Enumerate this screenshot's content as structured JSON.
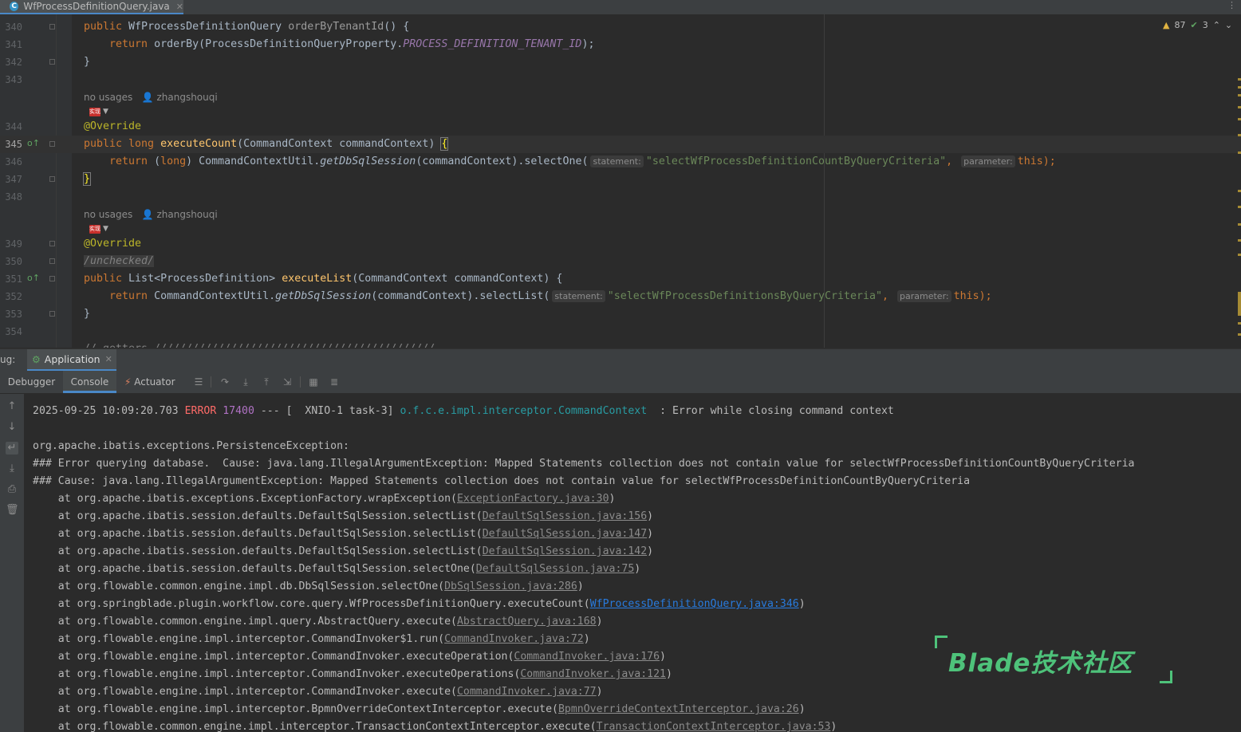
{
  "editor_tab": {
    "file_name": "WfProcessDefinitionQuery.java",
    "icon": "java-class-icon"
  },
  "inspections": {
    "warnings": "87",
    "checks": "3"
  },
  "editor_lines": [
    {
      "n": "340"
    },
    {
      "n": "341"
    },
    {
      "n": "342"
    },
    {
      "n": "343"
    },
    {
      "n": "344"
    },
    {
      "n": "345"
    },
    {
      "n": "346"
    },
    {
      "n": "347"
    },
    {
      "n": "348"
    },
    {
      "n": "349"
    },
    {
      "n": "350"
    },
    {
      "n": "351"
    },
    {
      "n": "352"
    },
    {
      "n": "353"
    },
    {
      "n": "354"
    }
  ],
  "code": {
    "l340a": "public ",
    "l340b": "WfProcessDefinitionQuery ",
    "l340c": "orderByTenantId",
    "l340d": "() {",
    "l341a": "    return ",
    "l341b": "orderBy(ProcessDefinitionQueryProperty.",
    "l341c": "PROCESS_DEFINITION_TENANT_ID",
    "l341d": ");",
    "l342": "}",
    "l344": "@Override",
    "l345a": "public long ",
    "l345b": "executeCount",
    "l345c": "(CommandContext commandContext) ",
    "l345d": "{",
    "l346a": "    return ",
    "l346b": "(long) ",
    "l346c": "CommandContextUtil.",
    "l346d": "getDbSqlSession",
    "l346e": "(commandContext).selectOne(",
    "l346s": "\"selectWfProcessDefinitionCountByQueryCriteria\"",
    "l346f": ", ",
    "l346g": "this",
    "l346h": ");",
    "l347": "}",
    "l349": "@Override",
    "l350": "/unchecked/",
    "l351a": "public ",
    "l351b": "List<ProcessDefinition> ",
    "l351c": "executeList",
    "l351d": "(CommandContext commandContext) {",
    "l352a": "    return ",
    "l352b": "CommandContextUtil.",
    "l352c": "getDbSqlSession",
    "l352d": "(commandContext).selectList(",
    "l352s": "\"selectWfProcessDefinitionsByQueryCriteria\"",
    "l352f": ", ",
    "l352g": "this",
    "l352h": ");",
    "l353": "}",
    "l355": "// getters ////////////////////////////////////////////"
  },
  "hints": {
    "statement": "statement:",
    "parameter": "parameter:"
  },
  "usage_meta": {
    "usages": "no usages",
    "author": "zhangshouqi",
    "badge": "实现"
  },
  "debug": {
    "label": "ug:",
    "session_tab": "Application",
    "tabs": {
      "debugger": "Debugger",
      "console": "Console",
      "actuator": "Actuator"
    }
  },
  "console": {
    "log_ts": "2025-09-25 10:09:20.703 ",
    "log_level": "ERROR",
    "log_pid": " 17400",
    "log_mid": " --- [  XNIO-1 task-3] ",
    "log_logger": "o.f.c.e.impl.interceptor.CommandContext",
    "log_msg": "  : Error while closing command context",
    "exc": "org.apache.ibatis.exceptions.PersistenceException:",
    "err1": "### Error querying database.  Cause: java.lang.IllegalArgumentException: Mapped Statements collection does not contain value for selectWfProcessDefinitionCountByQueryCriteria",
    "err2": "### Cause: java.lang.IllegalArgumentException: Mapped Statements collection does not contain value for selectWfProcessDefinitionCountByQueryCriteria",
    "frames": [
      {
        "pre": "    at org.apache.ibatis.exceptions.ExceptionFactory.wrapException(",
        "link": "ExceptionFactory.java:30"
      },
      {
        "pre": "    at org.apache.ibatis.session.defaults.DefaultSqlSession.selectList(",
        "link": "DefaultSqlSession.java:156"
      },
      {
        "pre": "    at org.apache.ibatis.session.defaults.DefaultSqlSession.selectList(",
        "link": "DefaultSqlSession.java:147"
      },
      {
        "pre": "    at org.apache.ibatis.session.defaults.DefaultSqlSession.selectList(",
        "link": "DefaultSqlSession.java:142"
      },
      {
        "pre": "    at org.apache.ibatis.session.defaults.DefaultSqlSession.selectOne(",
        "link": "DefaultSqlSession.java:75"
      },
      {
        "pre": "    at org.flowable.common.engine.impl.db.DbSqlSession.selectOne(",
        "link": "DbSqlSession.java:286"
      },
      {
        "pre": "    at org.springblade.plugin.workflow.core.query.WfProcessDefinitionQuery.executeCount(",
        "link": "WfProcessDefinitionQuery.java:346",
        "blue": true
      },
      {
        "pre": "    at org.flowable.common.engine.impl.query.AbstractQuery.execute(",
        "link": "AbstractQuery.java:168"
      },
      {
        "pre": "    at org.flowable.engine.impl.interceptor.CommandInvoker$1.run(",
        "link": "CommandInvoker.java:72"
      },
      {
        "pre": "    at org.flowable.engine.impl.interceptor.CommandInvoker.executeOperation(",
        "link": "CommandInvoker.java:176"
      },
      {
        "pre": "    at org.flowable.engine.impl.interceptor.CommandInvoker.executeOperations(",
        "link": "CommandInvoker.java:121"
      },
      {
        "pre": "    at org.flowable.engine.impl.interceptor.CommandInvoker.execute(",
        "link": "CommandInvoker.java:77"
      },
      {
        "pre": "    at org.flowable.engine.impl.interceptor.BpmnOverrideContextInterceptor.execute(",
        "link": "BpmnOverrideContextInterceptor.java:26"
      },
      {
        "pre": "    at org.flowable.common.engine.impl.interceptor.TransactionContextInterceptor.execute(",
        "link": "TransactionContextInterceptor.java:53"
      }
    ]
  },
  "watermark": "Blade技术社区"
}
